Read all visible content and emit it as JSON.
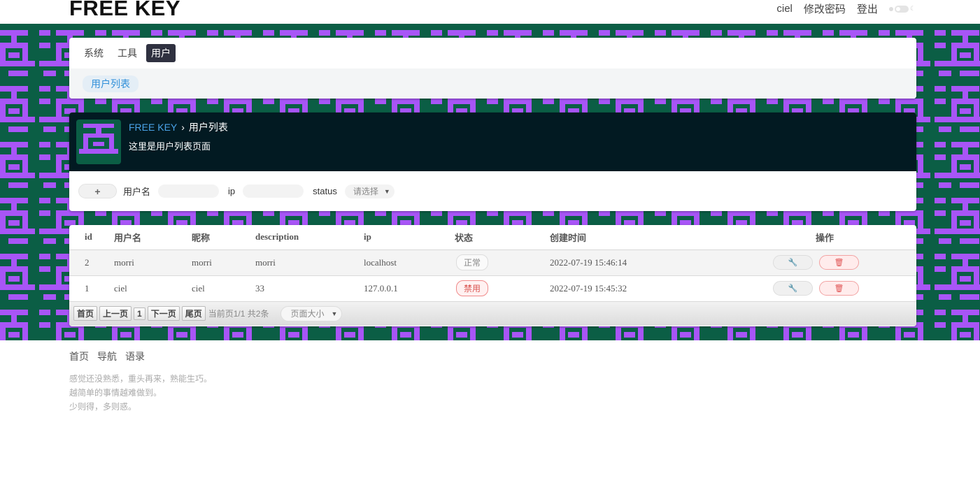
{
  "app": {
    "brand": "FREE KEY",
    "user": "ciel",
    "change_password": "修改密码",
    "logout": "登出"
  },
  "menu": {
    "items": [
      {
        "label": "系统",
        "active": false
      },
      {
        "label": "工具",
        "active": false
      },
      {
        "label": "用户",
        "active": true
      }
    ],
    "submenu": [
      {
        "label": "用户列表",
        "active": true
      }
    ]
  },
  "hero": {
    "breadcrumb_root": "FREE KEY",
    "breadcrumb_sep": "›",
    "breadcrumb_current": "用户列表",
    "description": "这里是用户列表页面"
  },
  "filters": {
    "add_icon": "+",
    "username_label": "用户名",
    "username_value": "",
    "ip_label": "ip",
    "ip_value": "",
    "status_label": "status",
    "status_placeholder": "请选择"
  },
  "table": {
    "columns": [
      "id",
      "用户名",
      "昵称",
      "description",
      "ip",
      "状态",
      "创建时间",
      "操作"
    ],
    "rows": [
      {
        "id": "2",
        "username": "morri",
        "nickname": "morri",
        "description": "morri",
        "ip": "localhost",
        "status": "正常",
        "status_type": "normal",
        "created": "2022-07-19 15:46:14"
      },
      {
        "id": "1",
        "username": "ciel",
        "nickname": "ciel",
        "description": "33",
        "ip": "127.0.0.1",
        "status": "禁用",
        "status_type": "disabled",
        "created": "2022-07-19 15:45:32"
      }
    ],
    "edit_icon": "wrench-icon",
    "delete_icon": "trash-icon"
  },
  "pager": {
    "first": "首页",
    "prev": "上一页",
    "page": "1",
    "next": "下一页",
    "last": "尾页",
    "info": "当前页1/1 共2条",
    "size_placeholder": "页面大小"
  },
  "footer": {
    "nav": [
      "首页",
      "导航",
      "语录"
    ],
    "quotes": [
      "感觉还没熟悉，重头再来，熟能生巧。",
      "越简单的事情越难做到。",
      "少则得，多则惑。"
    ]
  },
  "colors": {
    "band_bg": "#0b5e45",
    "pattern": "#a855f7",
    "hero_bg": "#021a22",
    "menu_active": "#2f3140",
    "link": "#2f8fd9",
    "danger": "#e05555"
  }
}
